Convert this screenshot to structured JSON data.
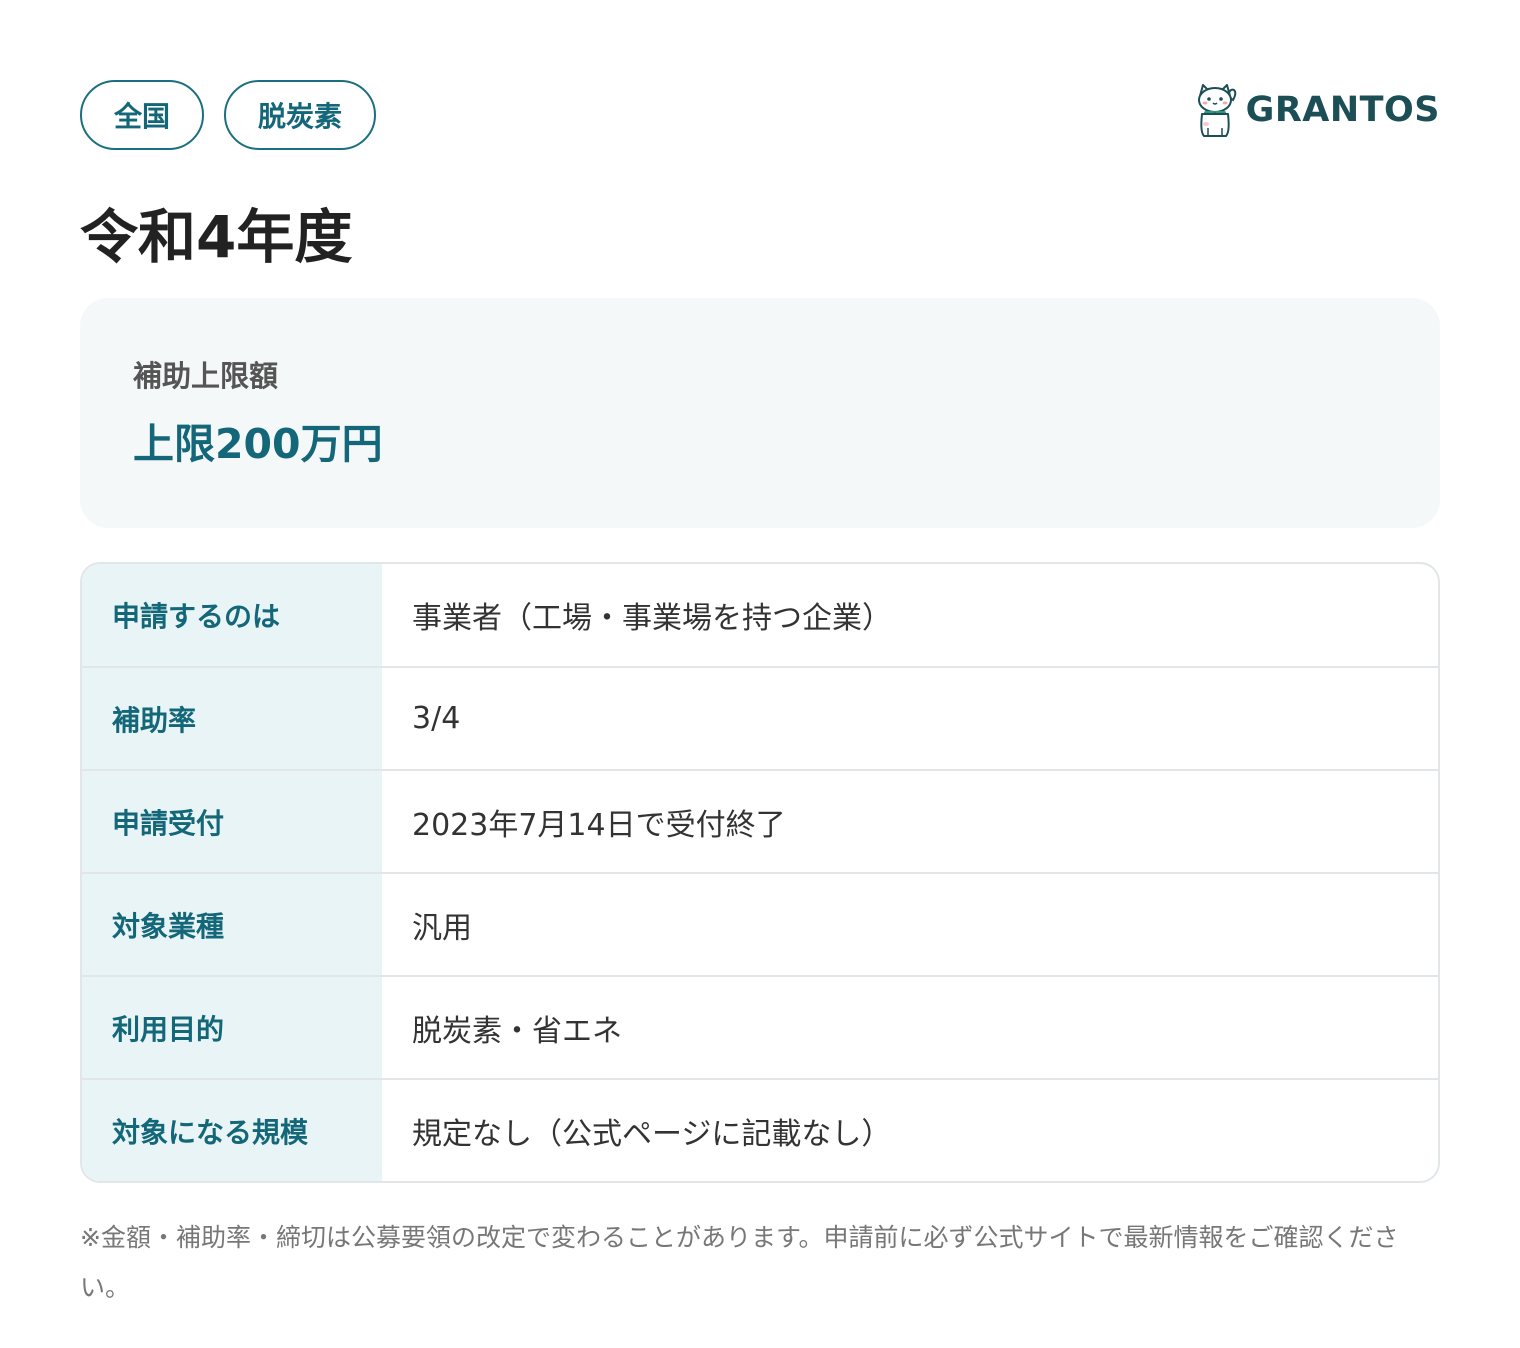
{
  "tags": [
    "全国",
    "脱炭素"
  ],
  "brand": {
    "name": "GRANTOS",
    "logo_icon": "maneki-neko-cat-icon",
    "colors": {
      "text": "#1c4e56",
      "accent": "#136779"
    }
  },
  "title": "令和4年度",
  "amount": {
    "label": "補助上限額",
    "value": "上限200万円"
  },
  "details": [
    {
      "key": "申請するのは",
      "value": "事業者（工場・事業場を持つ企業）"
    },
    {
      "key": "補助率",
      "value": "3/4"
    },
    {
      "key": "申請受付",
      "value": "2023年7月14日で受付終了"
    },
    {
      "key": "対象業種",
      "value": "汎用"
    },
    {
      "key": "利用目的",
      "value": "脱炭素・省エネ"
    },
    {
      "key": "対象になる規模",
      "value": "規定なし（公式ページに記載なし）"
    }
  ],
  "note": "※金額・補助率・締切は公募要領の改定で変わることがあります。申請前に必ず公式サイトで最新情報をご確認ください。"
}
